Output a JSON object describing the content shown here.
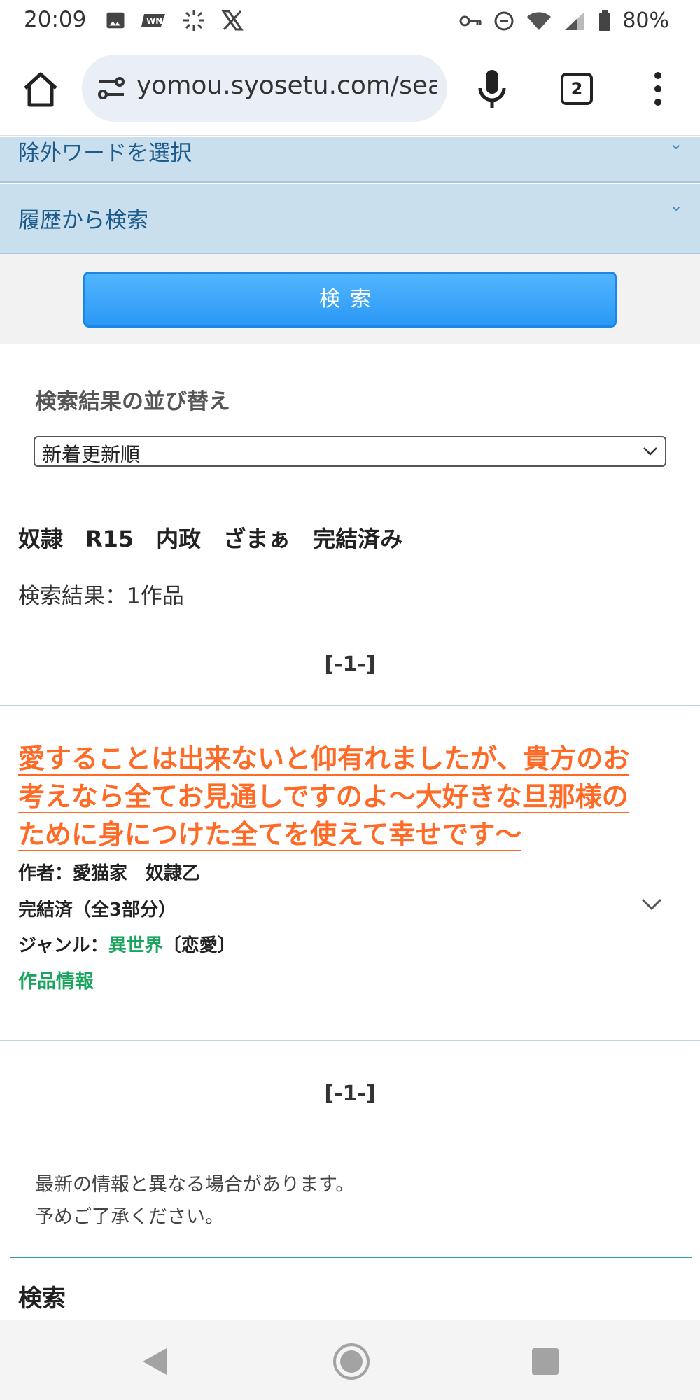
{
  "status_bar": {
    "time": "20:09",
    "battery": "80%",
    "icons_left": [
      "image-icon",
      "wni-app-icon",
      "radial-app-icon",
      "x-app-icon"
    ],
    "icons_right": [
      "vpn-key-icon",
      "dnd-icon",
      "wifi-icon",
      "signal-icon",
      "battery-icon"
    ]
  },
  "browser": {
    "url": "yomou.syosetu.com/sea",
    "tab_count": "2"
  },
  "accordions": [
    {
      "label": "除外ワードを選択"
    },
    {
      "label": "履歴から検索"
    }
  ],
  "search_button": "検索",
  "sort": {
    "title": "検索結果の並び替え",
    "selected": "新着更新順"
  },
  "keywords": "奴隷　R15　内政　ざまぁ　完結済み",
  "result_count": "検索結果：1作品",
  "pager": "[-1-]",
  "novel": {
    "title_lines": [
      "愛することは出来ないと仰有れましたが、貴方のお",
      "考えなら全てお見通しですのよ〜大好きな旦那様の",
      "ために身につけた全てを使えて幸せです〜"
    ],
    "author": "作者：愛猫家　奴隷乙",
    "status": "完結済（全3部分）",
    "genre_prefix": "ジャンル：",
    "genre_link": "異世界",
    "genre_suffix": "〔恋愛〕",
    "info_link": "作品情報"
  },
  "note": {
    "line1": "最新の情報と異なる場合があります。",
    "line2": "予めご了承ください。"
  },
  "footer_heading": "検索",
  "colors": {
    "accordion_bg": "#c9dfee",
    "search_button": "#2a98f5",
    "title_orange": "#ff6a26",
    "link_green": "#19a55d"
  }
}
